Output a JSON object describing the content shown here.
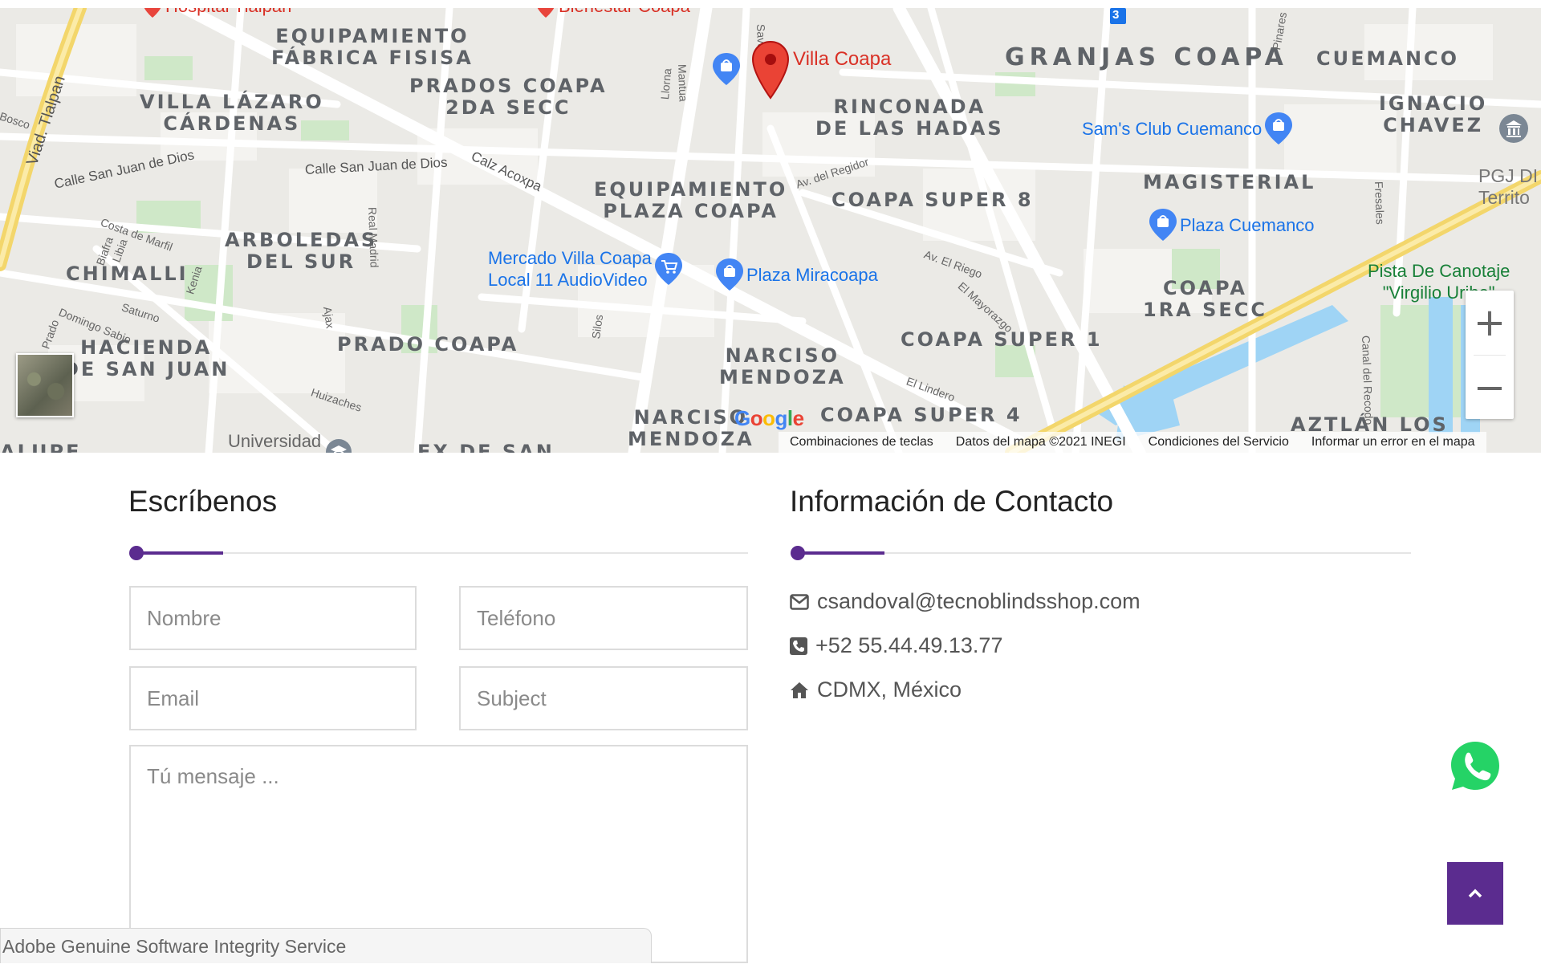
{
  "map": {
    "area_labels": [
      {
        "text": "EQUIPAMIENTO\nFÁBRICA FISISA",
        "big": false
      },
      {
        "text": "VILLA LÁZARO\nCÁRDENAS",
        "big": false
      },
      {
        "text": "PRADOS COAPA\n2DA SECC",
        "big": false
      },
      {
        "text": "GRANJAS COAPA",
        "big": true
      },
      {
        "text": "CUEMANCO",
        "big": false
      },
      {
        "text": "RINCONADA\nDE LAS HADAS",
        "big": false
      },
      {
        "text": "IGNACIO\nCHAVEZ",
        "big": false
      },
      {
        "text": "EQUIPAMIENTO\nPLAZA COAPA",
        "big": false
      },
      {
        "text": "COAPA SUPER 8",
        "big": false
      },
      {
        "text": "MAGISTERIAL",
        "big": false
      },
      {
        "text": "ARBOLEDAS\nDEL SUR",
        "big": false
      },
      {
        "text": "CHIMALLI",
        "big": false
      },
      {
        "text": "COAPA\n1RA SECC",
        "big": false
      },
      {
        "text": "HACIENDA\nDE SAN JUAN",
        "big": false
      },
      {
        "text": "PRADO COAPA",
        "big": false
      },
      {
        "text": "NARCISO\nMENDOZA",
        "big": false
      },
      {
        "text": "COAPA SUPER 1",
        "big": false
      },
      {
        "text": "NARCISO\nMENDOZA",
        "big": false
      },
      {
        "text": "COAPA SUPER 4",
        "big": false
      },
      {
        "text": "AZTLÁN LOS",
        "big": false
      },
      {
        "text": "EX DE SAN",
        "big": false
      },
      {
        "text": "ALUPE",
        "big": false
      }
    ],
    "street_labels": [
      {
        "text": "Viad. Tlalpan",
        "small": false
      },
      {
        "text": "Calle San Juan de Dios",
        "small": false
      },
      {
        "text": "Calle San Juan de Dios",
        "small": false
      },
      {
        "text": "Calz Acoxpa",
        "small": false
      },
      {
        "text": "Av. del Regidor",
        "small": true
      },
      {
        "text": "Av. El Riego",
        "small": true
      },
      {
        "text": "El Mayorazgo",
        "small": true
      },
      {
        "text": "El Lindero",
        "small": true
      },
      {
        "text": "Costa de Marfil",
        "small": true
      },
      {
        "text": "Biafra",
        "small": true
      },
      {
        "text": "Libia",
        "small": true
      },
      {
        "text": "Kenia",
        "small": true
      },
      {
        "text": "Saturno",
        "small": true
      },
      {
        "text": "Domingo Sabio",
        "small": true
      },
      {
        "text": "Prado",
        "small": true
      },
      {
        "text": "Real Madrid",
        "small": true
      },
      {
        "text": "Ajax",
        "small": true
      },
      {
        "text": "Silos",
        "small": true
      },
      {
        "text": "Huizaches",
        "small": true
      },
      {
        "text": "Mantua",
        "small": true
      },
      {
        "text": "Llorna",
        "small": true
      },
      {
        "text": "Fresales",
        "small": true
      },
      {
        "text": "Canal del Recodo",
        "small": true
      },
      {
        "text": "Pinares",
        "small": true
      },
      {
        "text": "Savo",
        "small": true
      },
      {
        "text": "Bosco",
        "small": true
      }
    ],
    "pois": [
      {
        "label": "Villa Coapa",
        "type": "red-marker"
      },
      {
        "label": "Hospital Tlalpan",
        "type": "red"
      },
      {
        "label": "Bienestar Coapa",
        "type": "red"
      },
      {
        "label": "Sam's Club Cuemanco",
        "type": "shop"
      },
      {
        "label": "Plaza Cuemanco",
        "type": "shop"
      },
      {
        "label": "Mercado Villa Coapa\nLocal 11 AudioVideo",
        "type": "cart"
      },
      {
        "label": "Plaza Miracoapa",
        "type": "shop"
      },
      {
        "label": "PGJ DI\nTerrito",
        "type": "gov"
      },
      {
        "label": "Pista De Canotaje\n\"Virgilio Uribe\"",
        "type": "green"
      },
      {
        "label": "Universidad\nAutónoma",
        "type": "edu"
      }
    ],
    "metro_badge": "3",
    "zoom_in_label": "+",
    "zoom_out_label": "−",
    "google_logo": "Google",
    "attributions": [
      "Combinaciones de teclas",
      "Datos del mapa ©2021 INEGI",
      "Condiciones del Servicio",
      "Informar un error en el mapa"
    ],
    "colors": {
      "major_road": "#f9e27d",
      "road": "#ffffff",
      "park": "#c8e6c9",
      "water": "#aadaff"
    }
  },
  "form": {
    "title": "Escríbenos",
    "name_placeholder": "Nombre",
    "phone_placeholder": "Teléfono",
    "email_placeholder": "Email",
    "subject_placeholder": "Subject",
    "message_placeholder": "Tú mensaje ..."
  },
  "contact": {
    "title": "Información de Contacto",
    "email": "csandoval@tecnoblindsshop.com",
    "phone": "+52 55.44.49.13.77",
    "address": "CDMX, México",
    "icons": [
      "envelope-icon",
      "phone-icon",
      "home-icon"
    ]
  },
  "accent_color": "#5b2c8f",
  "adobe_bar": "Adobe Genuine Software Integrity Service",
  "icons": {
    "whatsapp": "whatsapp-icon",
    "back_to_top": "chevron-up-icon"
  }
}
